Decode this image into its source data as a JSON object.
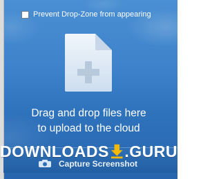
{
  "prevent_option": {
    "label": "Prevent Drop-Zone from appearing",
    "checked": false
  },
  "drop_zone": {
    "line1": "Drag and drop files here",
    "line2": "to upload to the cloud",
    "icon": "file-add-icon"
  },
  "capture": {
    "label": "Capture Screenshot",
    "icon": "camera-icon"
  },
  "watermark": {
    "left": "DOWNLOADS",
    "right": "GURU",
    "icon": "download-arrow-icon",
    "colors": {
      "arrow": "#f5b800",
      "text": "#ffffff"
    }
  },
  "colors": {
    "background_top": "#4a8fd2",
    "background_bottom": "#2766ae",
    "text": "#ffffff"
  }
}
